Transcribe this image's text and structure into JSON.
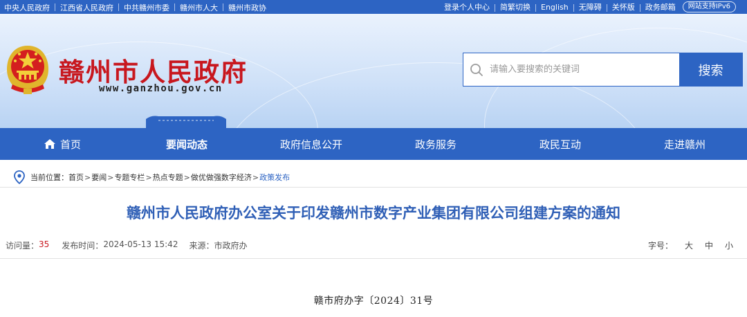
{
  "topbar": {
    "links": [
      "中央人民政府",
      "江西省人民政府",
      "中共赣州市委",
      "赣州市人大",
      "赣州市政协"
    ],
    "utility": [
      "登录个人中心",
      "简繁切换",
      "English",
      "无障碍",
      "关怀版",
      "政务邮箱"
    ],
    "ipv6": "网站支持IPv6"
  },
  "header": {
    "site_title": "赣州市人民政府",
    "site_url": "www.ganzhou.gov.cn",
    "search_placeholder": "请输入要搜索的关键词",
    "search_button": "搜索"
  },
  "nav": {
    "items": [
      {
        "label": "首页",
        "icon": "home-icon"
      },
      {
        "label": "要闻动态",
        "active": true
      },
      {
        "label": "政府信息公开"
      },
      {
        "label": "政务服务"
      },
      {
        "label": "政民互动"
      },
      {
        "label": "走进赣州"
      }
    ]
  },
  "breadcrumb": {
    "prefix": "当前位置：",
    "items": [
      "首页",
      "要闻",
      "专题专栏",
      "热点专题",
      "做优做强数字经济"
    ],
    "current": "政策发布"
  },
  "article": {
    "title": "赣州市人民政府办公室关于印发赣州市数字产业集团有限公司组建方案的通知",
    "views_label": "访问量：",
    "views": "35",
    "date_label": "发布时间：",
    "date": "2024-05-13 15:42",
    "source_label": "来源：",
    "source": "市政府办",
    "fontsize_label": "字号：",
    "fontsize_options": [
      "大",
      "中",
      "小"
    ],
    "doc_number": "赣市府办字〔2024〕31号"
  },
  "colors": {
    "brand_blue": "#2d64c3",
    "title_red": "#c8171e",
    "article_title_blue": "#2f5fb6"
  }
}
